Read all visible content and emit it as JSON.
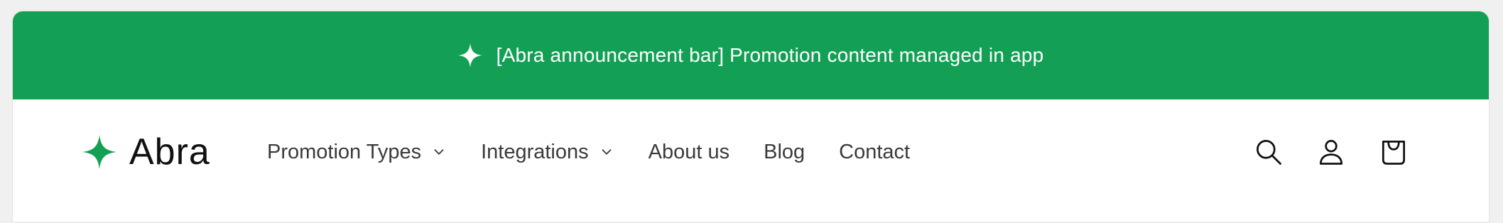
{
  "colors": {
    "brand": "#13a055",
    "text_nav": "#3a3a3a",
    "logo_text": "#111111"
  },
  "announcement": {
    "icon": "sparkle-icon",
    "text": "[Abra announcement bar] Promotion content managed in app"
  },
  "header": {
    "logo": {
      "icon": "sparkle-logo-icon",
      "text": "Abra"
    },
    "nav": [
      {
        "label": "Promotion Types",
        "has_dropdown": true
      },
      {
        "label": "Integrations",
        "has_dropdown": true
      },
      {
        "label": "About us",
        "has_dropdown": false
      },
      {
        "label": "Blog",
        "has_dropdown": false
      },
      {
        "label": "Contact",
        "has_dropdown": false
      }
    ],
    "icons": [
      "search-icon",
      "account-icon",
      "cart-icon"
    ]
  }
}
